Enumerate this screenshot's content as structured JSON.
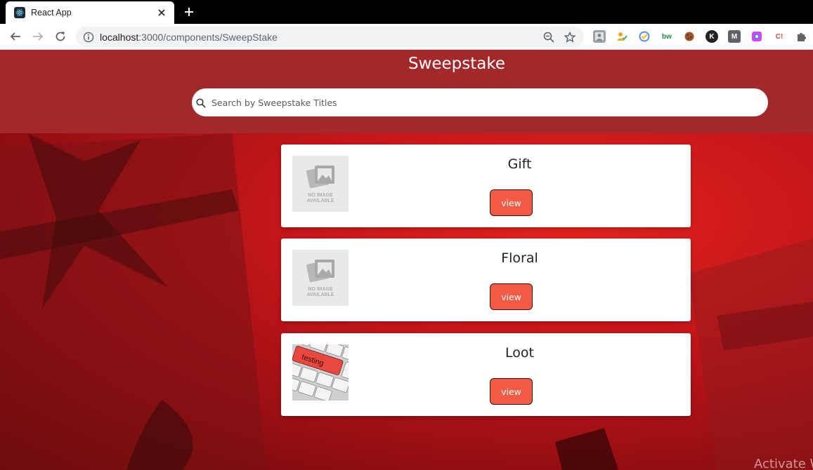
{
  "browser": {
    "tab_title": "React App",
    "url_host": "localhost",
    "url_path": ":3000/components/SweepStake"
  },
  "page": {
    "title": "Sweepstake",
    "search_placeholder": "Search by Sweepstake Titles",
    "cards": [
      {
        "title": "Gift",
        "button_label": "view",
        "image": "no-image-placeholder"
      },
      {
        "title": "Floral",
        "button_label": "view",
        "image": "no-image-placeholder"
      },
      {
        "title": "Loot",
        "button_label": "view",
        "image": "testing-keyboard-photo"
      }
    ],
    "placeholder_line1": "NO IMAGE",
    "placeholder_line2": "AVAILABLE",
    "keyboard_key_text": "testing"
  },
  "watermark": "Activate W",
  "colors": {
    "header_bg": "#a2282a",
    "button_bg": "#f35b45",
    "page_bg": "#c5161a"
  }
}
